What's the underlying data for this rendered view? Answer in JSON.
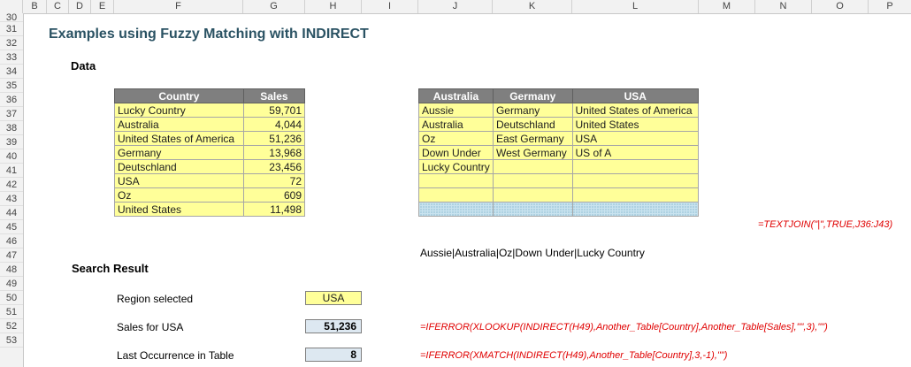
{
  "columns": [
    "B",
    "C",
    "D",
    "E",
    "F",
    "G",
    "H",
    "I",
    "J",
    "K",
    "L",
    "M",
    "N",
    "O",
    "P"
  ],
  "rows": [
    "30",
    "31",
    "32",
    "33",
    "34",
    "35",
    "36",
    "37",
    "38",
    "39",
    "40",
    "41",
    "42",
    "43",
    "44",
    "45",
    "46",
    "47",
    "48",
    "49",
    "50",
    "51",
    "52",
    "53"
  ],
  "title": "Examples using Fuzzy Matching with INDIRECT",
  "data_heading": "Data",
  "sales_table": {
    "headers": [
      "Country",
      "Sales"
    ],
    "rows": [
      [
        "Lucky Country",
        "59,701"
      ],
      [
        "Australia",
        "4,044"
      ],
      [
        "United States of America",
        "51,236"
      ],
      [
        "Germany",
        "13,968"
      ],
      [
        "Deutschland",
        "23,456"
      ],
      [
        "USA",
        "72"
      ],
      [
        "Oz",
        "609"
      ],
      [
        "United States",
        "11,498"
      ]
    ]
  },
  "alias_table": {
    "headers": [
      "Australia",
      "Germany",
      "USA"
    ],
    "rows": [
      [
        "Aussie",
        "Germany",
        "United States of America"
      ],
      [
        "Australia",
        "Deutschland",
        "United States"
      ],
      [
        "Oz",
        "East Germany",
        "USA"
      ],
      [
        "Down Under",
        "West Germany",
        "US of A"
      ],
      [
        "Lucky Country",
        "",
        ""
      ],
      [
        "",
        "",
        ""
      ],
      [
        "",
        "",
        ""
      ]
    ]
  },
  "textjoin_formula": "=TEXTJOIN(\"|\",TRUE,J36:J43)",
  "textjoin_result": "Aussie|Australia|Oz|Down Under|Lucky Country",
  "search_heading": "Search Result",
  "region_label": "Region selected",
  "region_value": "USA",
  "sales_label": "Sales for USA",
  "sales_value": "51,236",
  "sales_formula": "=IFERROR(XLOOKUP(INDIRECT(H49),Another_Table[Country],Another_Table[Sales],\"\",3),\"\")",
  "last_label": "Last Occurrence in Table",
  "last_value": "8",
  "last_formula": "=IFERROR(XMATCH(INDIRECT(H49),Another_Table[Country],3,-1),\"\")"
}
